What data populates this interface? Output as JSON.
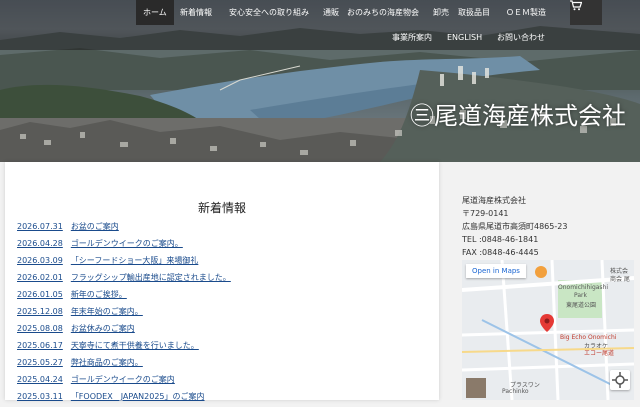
{
  "nav": {
    "row1": [
      {
        "label": "ホーム",
        "active": true
      },
      {
        "label": "新着情報"
      },
      {
        "label": "安心安全への取り組み"
      },
      {
        "label": "通販"
      },
      {
        "label": "おのみちの海産物会"
      },
      {
        "label": "卸売"
      },
      {
        "label": "取扱品目"
      },
      {
        "label": "ＯＥＭ製造"
      }
    ],
    "row2": [
      {
        "label": "事業所案内"
      },
      {
        "label": "ENGLISH"
      },
      {
        "label": "お問い合わせ"
      }
    ],
    "cart_icon": "cart-icon"
  },
  "hero": {
    "company_logo": "㊂尾道海産株式会社"
  },
  "news": {
    "title": "新着情報",
    "items": [
      {
        "date": "2026.07.31",
        "text": "お盆のご案内"
      },
      {
        "date": "2026.04.28",
        "text": "ゴールデンウイークのご案内。"
      },
      {
        "date": "2026.03.09",
        "text": "「シーフードショー大阪」来場御礼"
      },
      {
        "date": "2026.02.01",
        "text": "フラッグシップ輸出産地に認定されました。"
      },
      {
        "date": "2026.01.05",
        "text": "新年のご挨拶。"
      },
      {
        "date": "2025.12.08",
        "text": "年末年始のご案内。"
      },
      {
        "date": "2025.08.08",
        "text": "お盆休みのご案内"
      },
      {
        "date": "2025.06.17",
        "text": "天寧寺にて煮干供養を行いました。"
      },
      {
        "date": "2025.05.27",
        "text": "弊社商品のご案内。"
      },
      {
        "date": "2025.04.24",
        "text": "ゴールデンウイークのご案内"
      },
      {
        "date": "2025.03.11",
        "text": "「FOODEX　JAPAN2025」のご案内"
      }
    ]
  },
  "company": {
    "name": "尾道海産株式会社",
    "postal": "〒729-0141",
    "address": "広島県尾道市高須町4865-23",
    "tel": "TEL :0848-46-1841",
    "fax": "FAX :0848-46-4445"
  },
  "map": {
    "open_label": "Open in Maps",
    "labels": [
      "株式会",
      "商会 尾",
      "Onomichihigashi",
      "Park",
      "東尾道公園",
      "Big Echo Onomichi",
      "カラオケ",
      "エコー尾道",
      "プラスワン",
      "Pachinko"
    ]
  }
}
